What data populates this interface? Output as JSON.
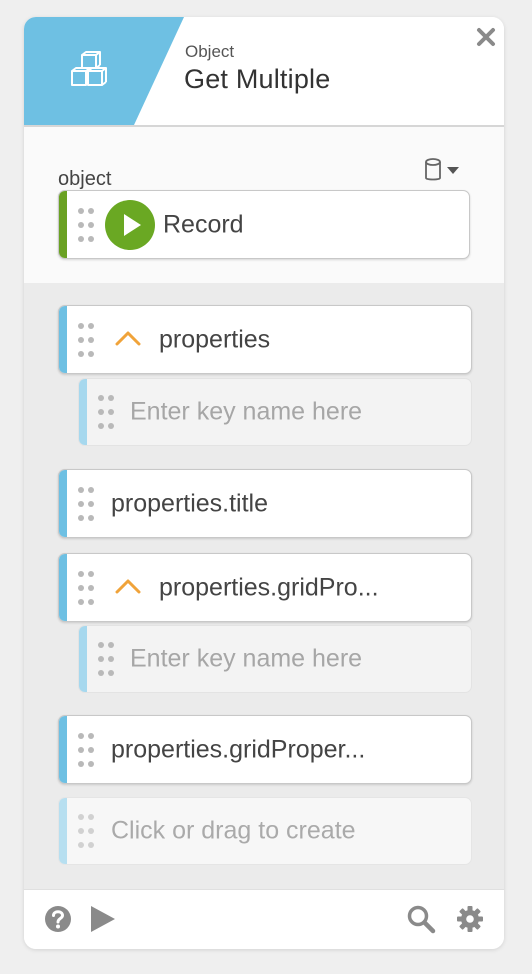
{
  "header": {
    "category": "Object",
    "title": "Get Multiple"
  },
  "object_section": {
    "label": "object",
    "value_block": {
      "label": "Record"
    }
  },
  "properties_list": {
    "items": [
      {
        "label": "properties",
        "child_placeholder": "Enter key name here"
      },
      {
        "label": "properties.title"
      },
      {
        "label": "properties.gridPro...",
        "child_placeholder": "Enter key name here"
      },
      {
        "label": "properties.gridProper..."
      }
    ],
    "create_placeholder": "Click or drag to create"
  },
  "colors": {
    "header_accent": "#6ec0e3",
    "object_bar": "#6aa123",
    "play_green": "#6aa823",
    "property_bar": "#6ec0e3",
    "chevron": "#f0a33a"
  },
  "icons": [
    "cubes-icon",
    "close-icon",
    "database-icon",
    "caret-down-icon",
    "play-icon",
    "chevron-up-icon",
    "help-icon",
    "search-icon",
    "gear-icon"
  ]
}
